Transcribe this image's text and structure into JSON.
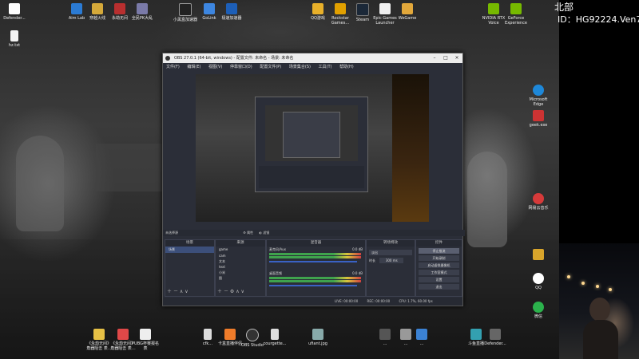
{
  "overlay": {
    "line1": "北部",
    "line2": "ID：HG92224.Ven7"
  },
  "desktop_icons": {
    "top": [
      {
        "label": "Defender...",
        "icon": "shield-icon"
      },
      {
        "label": "Aim Lab",
        "icon": "aimlab-icon"
      },
      {
        "label": "穿越火线",
        "icon": "game-icon"
      },
      {
        "label": "永劫无间",
        "icon": "game-icon"
      },
      {
        "label": "全民PK大乱",
        "icon": "game-icon"
      },
      {
        "label": "小黑盒加速器",
        "icon": "app-icon"
      },
      {
        "label": "GoLink",
        "icon": "golink-icon"
      },
      {
        "label": "极速加速器",
        "icon": "app-icon"
      },
      {
        "label": "QQ游戏",
        "icon": "qq-game-icon"
      },
      {
        "label": "Rockstar Games...",
        "icon": "rockstar-icon"
      },
      {
        "label": "Steam",
        "icon": "steam-icon"
      },
      {
        "label": "Epic Games Launcher",
        "icon": "epic-icon"
      },
      {
        "label": "WeGame",
        "icon": "wegame-icon"
      },
      {
        "label": "NVIDIA RTX Voice",
        "icon": "nvidia-icon"
      },
      {
        "label": "GeForce Experience",
        "icon": "geforce-icon"
      }
    ],
    "left": [
      {
        "label": "hz.txt",
        "icon": "file-icon"
      }
    ],
    "right": [
      {
        "label": "Microsoft Edge",
        "icon": "edge-icon"
      },
      {
        "label": "geek.exe",
        "icon": "exe-icon"
      },
      {
        "label": "网易云音乐",
        "icon": "netease-music-icon"
      },
      {
        "label": "",
        "icon": "app-icon"
      },
      {
        "label": "QQ",
        "icon": "qq-icon"
      },
      {
        "label": "微信",
        "icon": "wechat-icon"
      }
    ],
    "bottom": [
      {
        "label": "《永劫无间》 角器阻击 表…",
        "icon": "doc-icon"
      },
      {
        "label": "《永劫无间》 角器阻击 表…",
        "icon": "pdf-icon"
      },
      {
        "label": "PUBG杯赛报名 表",
        "icon": "pdf-icon"
      },
      {
        "label": "cfk...",
        "icon": "file-icon"
      },
      {
        "label": "卡盒直播伴侣",
        "icon": "app-icon"
      },
      {
        "label": "OBS Studio",
        "icon": "obs-icon"
      },
      {
        "label": "courgette...",
        "icon": "file-icon"
      },
      {
        "label": "ufiant.jpg",
        "icon": "image-icon"
      },
      {
        "label": "...",
        "icon": "app-icon"
      },
      {
        "label": "...",
        "icon": "app-icon"
      },
      {
        "label": "...",
        "icon": "app-icon"
      },
      {
        "label": "斗鱼直播",
        "icon": "app-icon"
      },
      {
        "label": "Defender...",
        "icon": "shield-icon"
      }
    ]
  },
  "obs": {
    "title": "OBS 27.0.1 (64-bit, windows) - 配置文件: 未命名 - 场景: 未命名",
    "menu": [
      "文件(F)",
      "编辑(E)",
      "视图(V)",
      "停靠窗口(D)",
      "配置文件(P)",
      "场景集合(S)",
      "工具(T)",
      "帮助(H)"
    ],
    "scene_bar": "未选择源",
    "scene_bar_props": "属性",
    "scene_bar_filters": "滤镜",
    "docks": {
      "scenes": {
        "title": "场景",
        "items": [
          "场景"
        ]
      },
      "sources": {
        "title": "来源",
        "items": [
          "game",
          "cam",
          "文本",
          "text",
          "小米",
          "图"
        ]
      },
      "mixer": {
        "title": "混音器",
        "tracks": [
          {
            "name": "麦克风/Aux",
            "db": "0.0 dB"
          },
          {
            "name": "桌面音频",
            "db": "0.0 dB"
          }
        ]
      },
      "transitions": {
        "title": "转场特效",
        "type": "淡出",
        "duration_label": "时长",
        "duration": "300 ms"
      },
      "controls": {
        "title": "控件",
        "buttons": [
          "停止推流",
          "开始录制",
          "启动虚拟摄像机",
          "工作室模式",
          "设置",
          "退出"
        ]
      }
    },
    "status": {
      "live": "LIVE: 00:00:00",
      "rec": "REC: 00:00:00",
      "cpu": "CPU: 1.7%, 60.00 fps"
    }
  }
}
